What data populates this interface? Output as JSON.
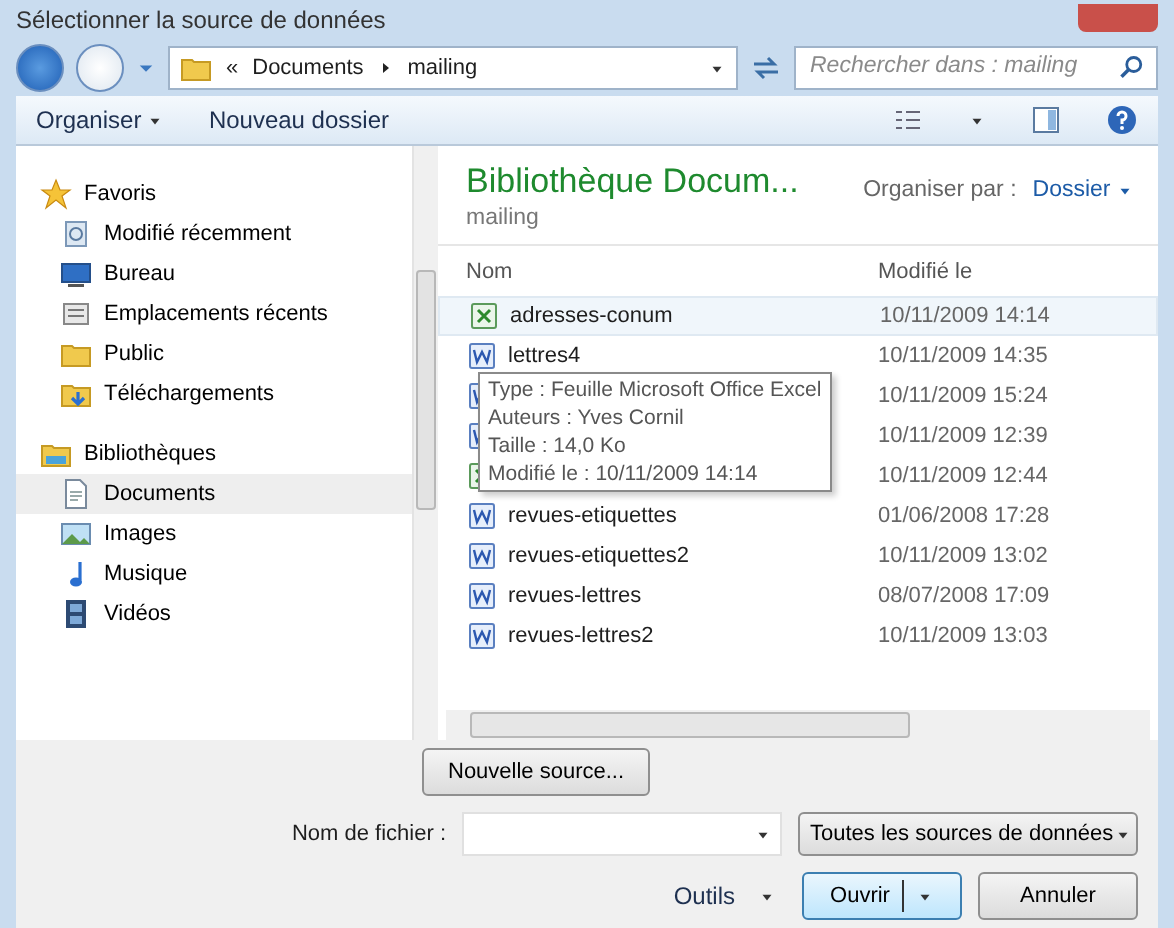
{
  "window": {
    "title": "Sélectionner la source de données"
  },
  "address_bar": {
    "overflow": "«",
    "path": [
      "Documents",
      "mailing"
    ]
  },
  "search": {
    "placeholder": "Rechercher dans : mailing"
  },
  "toolbar": {
    "organise": "Organiser",
    "new_folder": "Nouveau dossier"
  },
  "nav": [
    {
      "label": "Favoris",
      "selected": false,
      "children": [
        {
          "label": "Modifié récemment",
          "selected": false
        },
        {
          "label": "Bureau",
          "selected": false
        },
        {
          "label": "Emplacements récents",
          "selected": false
        },
        {
          "label": "Public",
          "selected": false
        },
        {
          "label": "Téléchargements",
          "selected": false
        }
      ]
    },
    {
      "label": "Bibliothèques",
      "selected": false,
      "children": [
        {
          "label": "Documents",
          "selected": true
        },
        {
          "label": "Images",
          "selected": false
        },
        {
          "label": "Musique",
          "selected": false
        },
        {
          "label": "Vidéos",
          "selected": false
        }
      ]
    }
  ],
  "library_header": {
    "title": "Bibliothèque Docum...",
    "subtitle": "mailing",
    "arrange_label": "Organiser par :",
    "arrange_value": "Dossier"
  },
  "columns": [
    "Nom",
    "Modifié le"
  ],
  "files": [
    {
      "name": "adresses-conum",
      "modified": "10/11/2009 14:14",
      "kind": "excel",
      "hovered": true
    },
    {
      "name": "lettres4",
      "modified": "10/11/2009 14:35",
      "kind": "word",
      "hovered": false
    },
    {
      "modified": "10/11/2009 15:24",
      "kind": "word",
      "hovered": false
    },
    {
      "modified": "10/11/2009 12:39",
      "kind": "word",
      "hovered": false
    },
    {
      "modified": "10/11/2009 12:44",
      "kind": "excel",
      "hovered": false
    },
    {
      "name": "revues-etiquettes",
      "modified": "01/06/2008 17:28",
      "kind": "word",
      "hovered": false
    },
    {
      "name": "revues-etiquettes2",
      "modified": "10/11/2009 13:02",
      "kind": "word",
      "hovered": false
    },
    {
      "name": "revues-lettres",
      "modified": "08/07/2008 17:09",
      "kind": "word",
      "hovered": false
    },
    {
      "name": "revues-lettres2",
      "modified": "10/11/2009 13:03",
      "kind": "word",
      "hovered": false
    }
  ],
  "tooltip": [
    "Type : Feuille Microsoft Office Excel",
    "Auteurs : Yves Cornil",
    "Taille : 14,0 Ko",
    "Modifié le : 10/11/2009 14:14"
  ],
  "new_source_button": "Nouvelle source...",
  "filename": {
    "label": "Nom de fichier :"
  },
  "filter": "Toutes les sources de données",
  "tools": "Outils",
  "open": "Ouvrir",
  "cancel": "Annuler"
}
